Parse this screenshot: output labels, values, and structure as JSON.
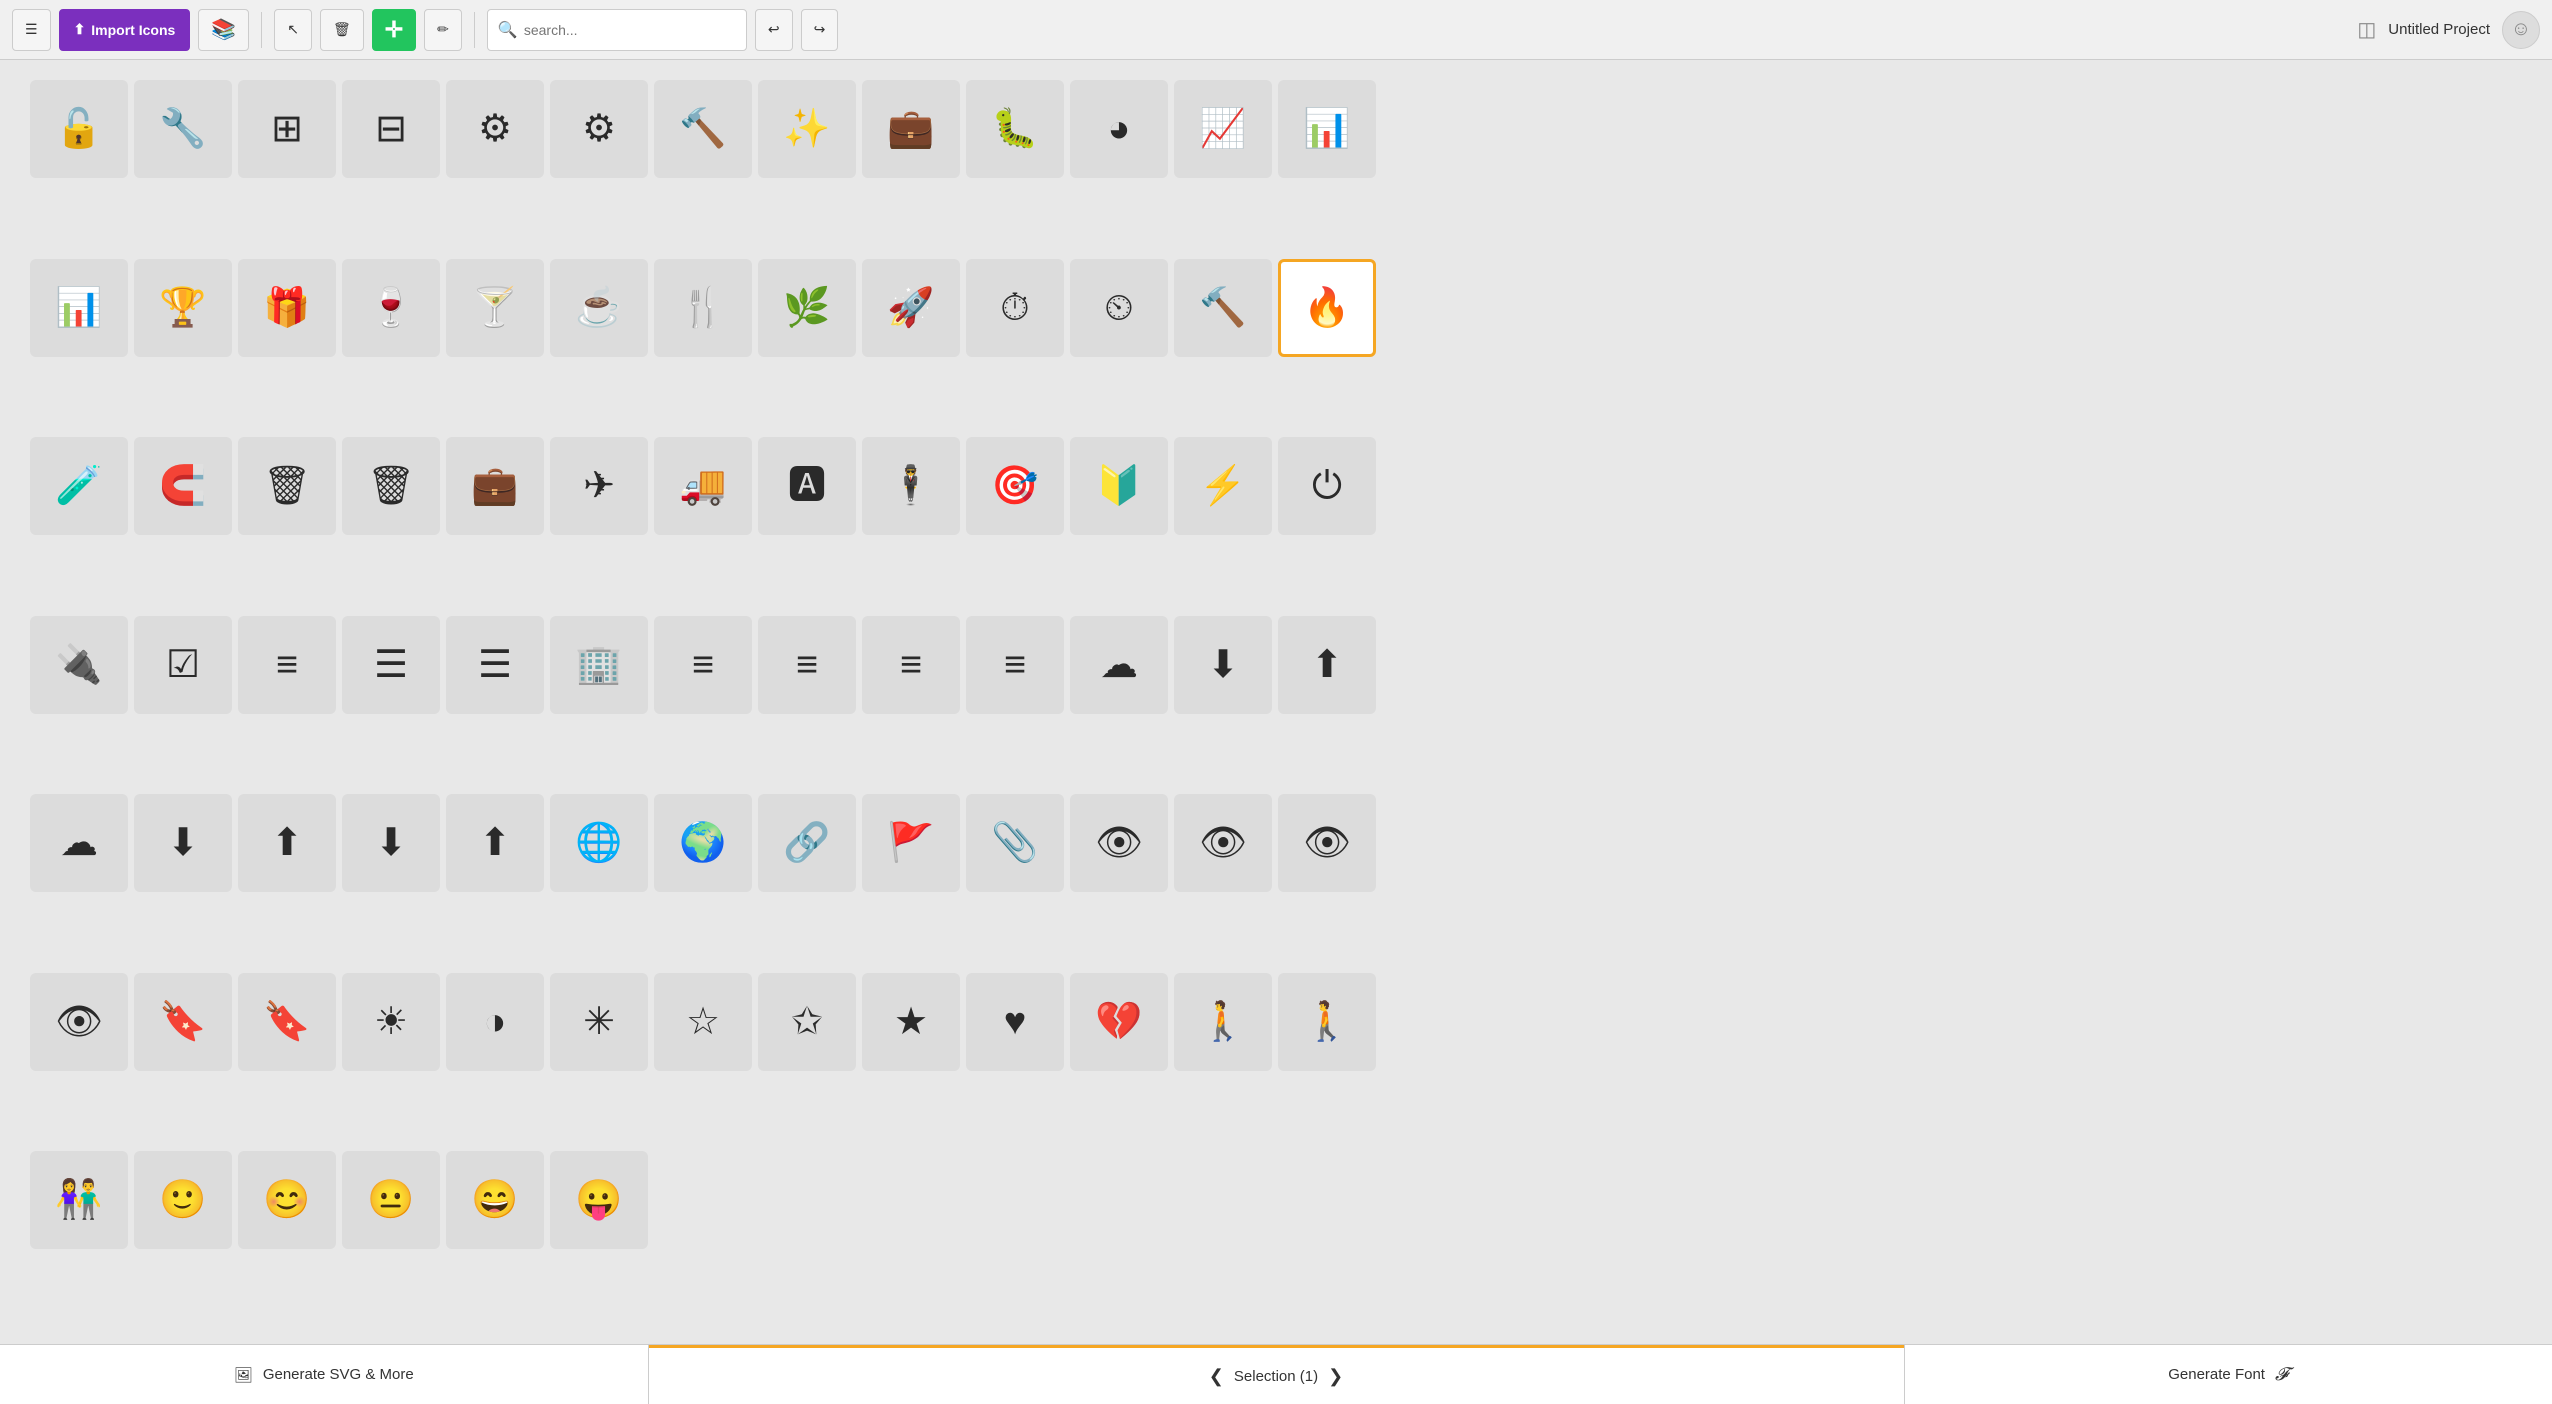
{
  "toolbar": {
    "menu_icon": "☰",
    "import_label": "Import Icons",
    "library_icon": "📚",
    "select_tool": "▶",
    "delete_tool": "🗑",
    "move_tool": "+",
    "edit_tool": "✏",
    "search_placeholder": "search...",
    "undo_icon": "↩",
    "redo_icon": "↪",
    "layers_icon": "◫",
    "project_name": "Untitled Project",
    "avatar_icon": "☺"
  },
  "bottom_bar": {
    "generate_svg_label": "Generate SVG & More",
    "selection_label": "Selection (1)",
    "generate_font_label": "Generate Font",
    "font_icon": "𝓕",
    "image_icon": "🖼"
  },
  "icons": [
    {
      "id": 1,
      "symbol": "🔓",
      "label": "unlock"
    },
    {
      "id": 2,
      "symbol": "🔧",
      "label": "wrench"
    },
    {
      "id": 3,
      "symbol": "⊞",
      "label": "sliders-h"
    },
    {
      "id": 4,
      "symbol": "⊟",
      "label": "sliders-v"
    },
    {
      "id": 5,
      "symbol": "⚙",
      "label": "gear"
    },
    {
      "id": 6,
      "symbol": "⚙",
      "label": "gear-alt"
    },
    {
      "id": 7,
      "symbol": "🔨",
      "label": "hammer"
    },
    {
      "id": 8,
      "symbol": "✨",
      "label": "magic"
    },
    {
      "id": 9,
      "symbol": "💼",
      "label": "briefcase-medical"
    },
    {
      "id": 10,
      "symbol": "🐛",
      "label": "bug"
    },
    {
      "id": 11,
      "symbol": "◕",
      "label": "pie-chart"
    },
    {
      "id": 12,
      "symbol": "📈",
      "label": "line-chart"
    },
    {
      "id": 13,
      "symbol": "📊",
      "label": "bar-chart"
    },
    {
      "id": 14,
      "symbol": "📊",
      "label": "bar-chart-alt"
    },
    {
      "id": 15,
      "symbol": "🏆",
      "label": "trophy"
    },
    {
      "id": 16,
      "symbol": "🎁",
      "label": "gift"
    },
    {
      "id": 17,
      "symbol": "🍷",
      "label": "wine-glass"
    },
    {
      "id": 18,
      "symbol": "🍸",
      "label": "cocktail"
    },
    {
      "id": 19,
      "symbol": "☕",
      "label": "mug"
    },
    {
      "id": 20,
      "symbol": "🍴",
      "label": "cutlery"
    },
    {
      "id": 21,
      "symbol": "🌿",
      "label": "leaf"
    },
    {
      "id": 22,
      "symbol": "🚀",
      "label": "rocket"
    },
    {
      "id": 23,
      "symbol": "⏱",
      "label": "speedometer"
    },
    {
      "id": 24,
      "symbol": "⏲",
      "label": "dial"
    },
    {
      "id": 25,
      "symbol": "🔨",
      "label": "gavel"
    },
    {
      "id": 26,
      "symbol": "🔥",
      "label": "fire",
      "selected": true
    },
    {
      "id": 27,
      "symbol": "🧪",
      "label": "flask"
    },
    {
      "id": 28,
      "symbol": "🧲",
      "label": "magnet"
    },
    {
      "id": 29,
      "symbol": "🗑",
      "label": "trash"
    },
    {
      "id": 30,
      "symbol": "🗑",
      "label": "trash-alt"
    },
    {
      "id": 31,
      "symbol": "💼",
      "label": "toolbox"
    },
    {
      "id": 32,
      "symbol": "✈",
      "label": "plane"
    },
    {
      "id": 33,
      "symbol": "🚚",
      "label": "truck"
    },
    {
      "id": 34,
      "symbol": "🅰",
      "label": "text"
    },
    {
      "id": 35,
      "symbol": "🕴",
      "label": "person"
    },
    {
      "id": 36,
      "symbol": "🎯",
      "label": "crosshair"
    },
    {
      "id": 37,
      "symbol": "🔰",
      "label": "shield-badge"
    },
    {
      "id": 38,
      "symbol": "⚡",
      "label": "bolt"
    },
    {
      "id": 39,
      "symbol": "⏻",
      "label": "power"
    },
    {
      "id": 40,
      "symbol": "🔌",
      "label": "plug"
    },
    {
      "id": 41,
      "symbol": "☑",
      "label": "checklist"
    },
    {
      "id": 42,
      "symbol": "≡",
      "label": "list-ol"
    },
    {
      "id": 43,
      "symbol": "☰",
      "label": "list"
    },
    {
      "id": 44,
      "symbol": "☰",
      "label": "list-alt"
    },
    {
      "id": 45,
      "symbol": "🏢",
      "label": "sitemap"
    },
    {
      "id": 46,
      "symbol": "≡",
      "label": "align-justify"
    },
    {
      "id": 47,
      "symbol": "≡",
      "label": "align-center-alt"
    },
    {
      "id": 48,
      "symbol": "≡",
      "label": "align-right-alt"
    },
    {
      "id": 49,
      "symbol": "≡",
      "label": "list-push"
    },
    {
      "id": 50,
      "symbol": "☁",
      "label": "cloud"
    },
    {
      "id": 51,
      "symbol": "⬇",
      "label": "cloud-download"
    },
    {
      "id": 52,
      "symbol": "⬆",
      "label": "cloud-upload"
    },
    {
      "id": 53,
      "symbol": "☁",
      "label": "cloud-check"
    },
    {
      "id": 54,
      "symbol": "⬇",
      "label": "download-alt"
    },
    {
      "id": 55,
      "symbol": "⬆",
      "label": "upload-alt"
    },
    {
      "id": 56,
      "symbol": "⬇",
      "label": "download2"
    },
    {
      "id": 57,
      "symbol": "⬆",
      "label": "upload2"
    },
    {
      "id": 58,
      "symbol": "🌐",
      "label": "globe"
    },
    {
      "id": 59,
      "symbol": "🌍",
      "label": "globe-alt"
    },
    {
      "id": 60,
      "symbol": "🔗",
      "label": "link"
    },
    {
      "id": 61,
      "symbol": "🚩",
      "label": "flag"
    },
    {
      "id": 62,
      "symbol": "📎",
      "label": "paperclip"
    },
    {
      "id": 63,
      "symbol": "👁",
      "label": "eye"
    },
    {
      "id": 64,
      "symbol": "👁",
      "label": "eye-plus"
    },
    {
      "id": 65,
      "symbol": "👁",
      "label": "eye-refresh"
    },
    {
      "id": 66,
      "symbol": "👁",
      "label": "eye-off"
    },
    {
      "id": 67,
      "symbol": "🔖",
      "label": "bookmark"
    },
    {
      "id": 68,
      "symbol": "🔖",
      "label": "bookmark-open"
    },
    {
      "id": 69,
      "symbol": "☀",
      "label": "sun"
    },
    {
      "id": 70,
      "symbol": "◑",
      "label": "contrast"
    },
    {
      "id": 71,
      "symbol": "✳",
      "label": "sun-alt"
    },
    {
      "id": 72,
      "symbol": "☆",
      "label": "star-empty"
    },
    {
      "id": 73,
      "symbol": "✩",
      "label": "star-half"
    },
    {
      "id": 74,
      "symbol": "★",
      "label": "star"
    },
    {
      "id": 75,
      "symbol": "♥",
      "label": "heart"
    },
    {
      "id": 76,
      "symbol": "💔",
      "label": "heart-broken"
    },
    {
      "id": 77,
      "symbol": "🚶",
      "label": "person-single"
    },
    {
      "id": 78,
      "symbol": "🚶",
      "label": "person-female"
    },
    {
      "id": 79,
      "symbol": "👫",
      "label": "persons-couple"
    },
    {
      "id": 80,
      "symbol": "🙂",
      "label": "smiley"
    },
    {
      "id": 81,
      "symbol": "😊",
      "label": "smiley-happy"
    },
    {
      "id": 82,
      "symbol": "😐",
      "label": "smiley-neutral"
    },
    {
      "id": 83,
      "symbol": "😄",
      "label": "smiley-grin"
    },
    {
      "id": 84,
      "symbol": "😛",
      "label": "smiley-tongue"
    }
  ]
}
